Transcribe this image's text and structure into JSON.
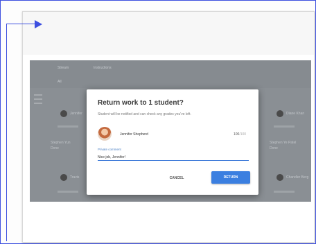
{
  "background_screen": {
    "tabs": [
      "Stream",
      "Instructions"
    ],
    "filter_label": "All",
    "left_students": [
      {
        "name": "Jennifer",
        "status": ""
      },
      {
        "name": "Stephen Yun",
        "status": "Done"
      },
      {
        "name": "Travis",
        "status": ""
      }
    ],
    "right_students": [
      {
        "name": "Diane Khan",
        "status": ""
      },
      {
        "name": "Stephen Ye Patel",
        "status": "Done"
      },
      {
        "name": "Chandler Berg",
        "status": ""
      }
    ]
  },
  "dialog": {
    "title": "Return work to 1 student?",
    "subtitle": "Student will be notified and can check any grades you've left.",
    "student_name": "Jennifer Shepherd",
    "grade_value": "100",
    "grade_denominator": "/100",
    "comment_label": "Private comment",
    "comment_value": "Nice job, Jennifer!",
    "cancel_label": "CANCEL",
    "return_label": "RETURN"
  },
  "colors": {
    "accent": "#3b7fe0",
    "callout": "#3d4fe0",
    "overlay": "#8a8f94"
  }
}
